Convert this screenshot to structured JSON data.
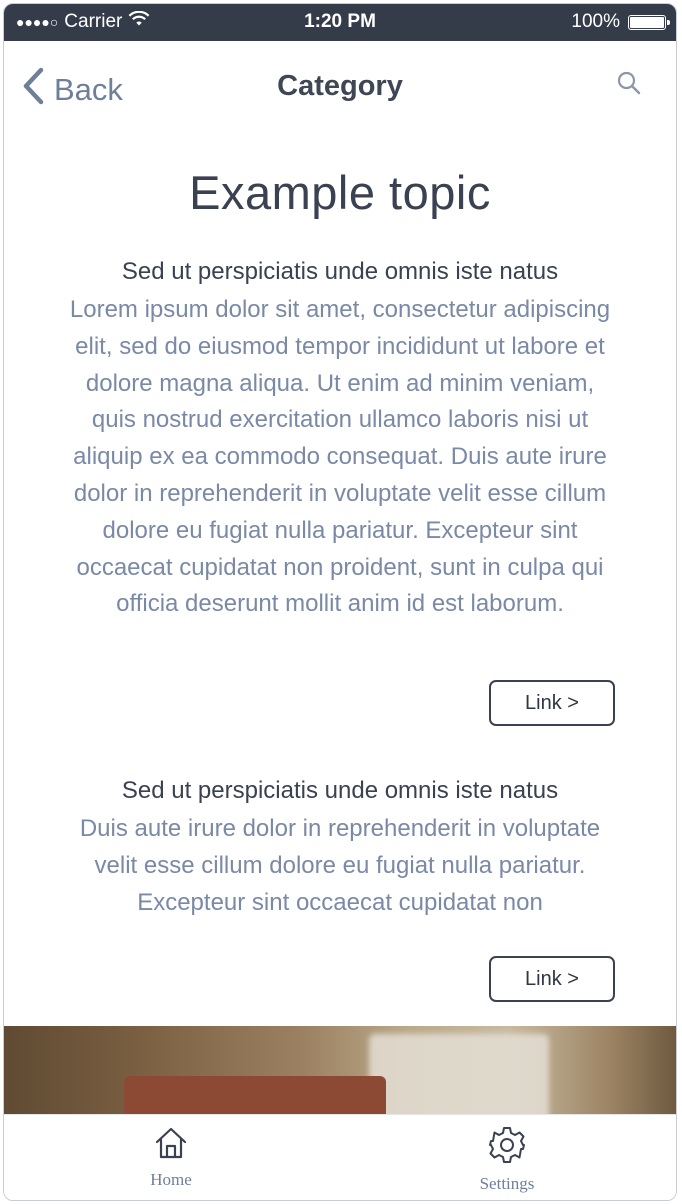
{
  "status_bar": {
    "signal_dots": "●●●●○",
    "carrier": "Carrier",
    "time": "1:20 PM",
    "battery_percent": "100%"
  },
  "nav": {
    "back_label": "Back",
    "title": "Category",
    "search_icon": "search-icon"
  },
  "main": {
    "topic_title": "Example topic",
    "sections": [
      {
        "heading": "Sed ut perspiciatis unde omnis iste natus",
        "body": "Lorem ipsum dolor sit amet, consectetur adipiscing elit, sed do eiusmod tempor incididunt ut labore et dolore magna aliqua. Ut enim ad minim veniam, quis nostrud exercitation ullamco laboris nisi ut aliquip ex ea commodo consequat. Duis aute irure dolor in reprehenderit in voluptate velit esse cillum dolore eu fugiat nulla pariatur. Excepteur sint occaecat cupidatat non proident, sunt in culpa qui officia deserunt mollit anim id est laborum.",
        "link_label": "Link >"
      },
      {
        "heading": "Sed ut perspiciatis unde omnis iste natus",
        "body": "Duis aute irure dolor in reprehenderit in voluptate velit esse cillum dolore eu fugiat nulla pariatur. Excepteur sint occaecat cupidatat non",
        "link_label": "Link >"
      }
    ]
  },
  "tab_bar": {
    "tabs": [
      {
        "label": "Home",
        "icon": "home-icon"
      },
      {
        "label": "Settings",
        "icon": "gear-icon"
      }
    ]
  },
  "colors": {
    "status_bar_bg": "#343c4a",
    "accent_text": "#7a89a6",
    "heading_text": "#3a4150"
  }
}
